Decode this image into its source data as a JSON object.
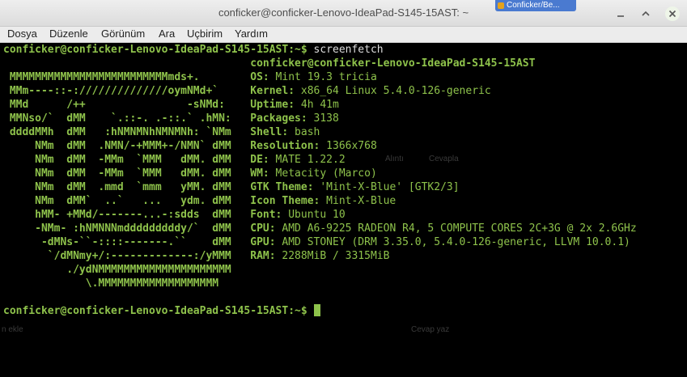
{
  "window": {
    "title": "conficker@conficker-Lenovo-IdeaPad-S145-15AST: ~",
    "background_tab": "Conficker/Be..."
  },
  "menu": [
    "Dosya",
    "Düzenle",
    "Görünüm",
    "Ara",
    "Uçbirim",
    "Yardım"
  ],
  "terminal": {
    "prompt": "conficker@conficker-Lenovo-IdeaPad-S145-15AST",
    "prompt_suffix": ":~$ ",
    "command": "screenfetch",
    "logo": [
      "",
      " MMMMMMMMMMMMMMMMMMMMMMMMMmds+.",
      " MMm----::-://////////////oymNMd+`",
      " MMd      /++                -sNMd:",
      " MMNso/`  dMM    `.::-. .-::.` .hMN:",
      " ddddMMh  dMM   :hNMNMNhNMNMNh: `NMm",
      "     NMm  dMM  .NMN/-+MMM+-/NMN` dMM",
      "     NMm  dMM  -MMm  `MMM   dMM. dMM",
      "     NMm  dMM  -MMm  `MMM   dMM. dMM",
      "     NMm  dMM  .mmd  `mmm   yMM. dMM",
      "     NMm  dMM`  ..`   ...   ydm. dMM",
      "     hMM- +MMd/-------...-:sdds  dMM",
      "     -NMm- :hNMNNNmdddddddddy/`  dMM",
      "      -dMNs-``-::::-------.``    dMM",
      "       `/dMNmy+/:-------------:/yMMM",
      "          ./ydNMMMMMMMMMMMMMMMMMMMMM",
      "             \\.MMMMMMMMMMMMMMMMMMM"
    ],
    "info_title": "conficker@conficker-Lenovo-IdeaPad-S145-15AST",
    "info": [
      {
        "label": "OS:",
        "value": " Mint 19.3 tricia"
      },
      {
        "label": "Kernel:",
        "value": " x86_64 Linux 5.4.0-126-generic"
      },
      {
        "label": "Uptime:",
        "value": " 4h 41m"
      },
      {
        "label": "Packages:",
        "value": " 3138"
      },
      {
        "label": "Shell:",
        "value": " bash"
      },
      {
        "label": "Resolution:",
        "value": " 1366x768"
      },
      {
        "label": "DE:",
        "value": " MATE 1.22.2"
      },
      {
        "label": "WM:",
        "value": " Metacity (Marco)"
      },
      {
        "label": "GTK Theme:",
        "value": " 'Mint-X-Blue' [GTK2/3]"
      },
      {
        "label": "Icon Theme:",
        "value": " Mint-X-Blue"
      },
      {
        "label": "Font:",
        "value": " Ubuntu 10"
      },
      {
        "label": "CPU:",
        "value": " AMD A6-9225 RADEON R4, 5 COMPUTE CORES 2C+3G @ 2x 2.6GHz"
      },
      {
        "label": "GPU:",
        "value": " AMD STONEY (DRM 3.35.0, 5.4.0-126-generic, LLVM 10.0.1)"
      },
      {
        "label": "RAM:",
        "value": " 2288MiB / 3315MiB"
      }
    ]
  },
  "ghost_text": [
    "Alıntı",
    "Cevapla",
    "Cevap yaz",
    "n ekle"
  ]
}
